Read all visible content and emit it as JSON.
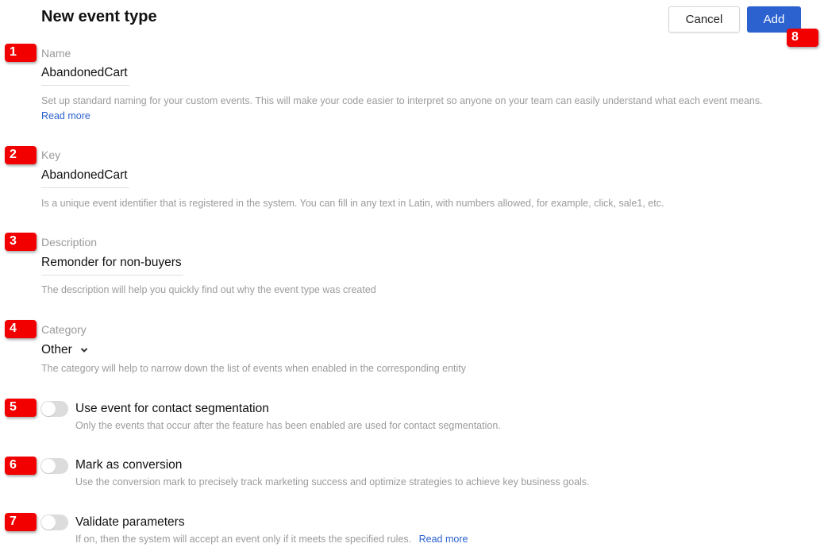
{
  "header": {
    "title": "New event type",
    "cancel_label": "Cancel",
    "add_label": "Add"
  },
  "annotations": [
    "1",
    "2",
    "3",
    "4",
    "5",
    "6",
    "7",
    "8"
  ],
  "fields": {
    "name": {
      "label": "Name",
      "value": "AbandonedCart",
      "help": "Set up standard naming for your custom events. This will make your code easier to interpret so anyone on your team can easily understand what each event means.",
      "link": "Read more"
    },
    "key": {
      "label": "Key",
      "value": "AbandonedCart",
      "help": "Is a unique event identifier that is registered in the system. You can fill in any text in Latin, with numbers allowed, for example, click, sale1, etc."
    },
    "description": {
      "label": "Description",
      "value": "Remonder for non-buyers",
      "help": "The description will help you quickly find out why the event type was created"
    },
    "category": {
      "label": "Category",
      "selected": "Other",
      "icon": "chevron-down-icon",
      "help": "The category will help to narrow down the list of events when enabled in the corresponding entity"
    }
  },
  "toggles": [
    {
      "title": "Use event for contact segmentation",
      "help": "Only the events that occur after the feature has been enabled are used for contact segmentation.",
      "on": false
    },
    {
      "title": "Mark as conversion",
      "help": "Use the conversion mark to precisely track marketing success and optimize strategies to achieve key business goals.",
      "on": false
    },
    {
      "title": "Validate parameters",
      "help": "If on, then the system will accept an event only if it meets the specified rules.",
      "link": "Read more",
      "on": false
    }
  ],
  "colors": {
    "accent": "#2c62d0",
    "annotation": "#f20000",
    "toggle_off": "#dcdcdc"
  }
}
